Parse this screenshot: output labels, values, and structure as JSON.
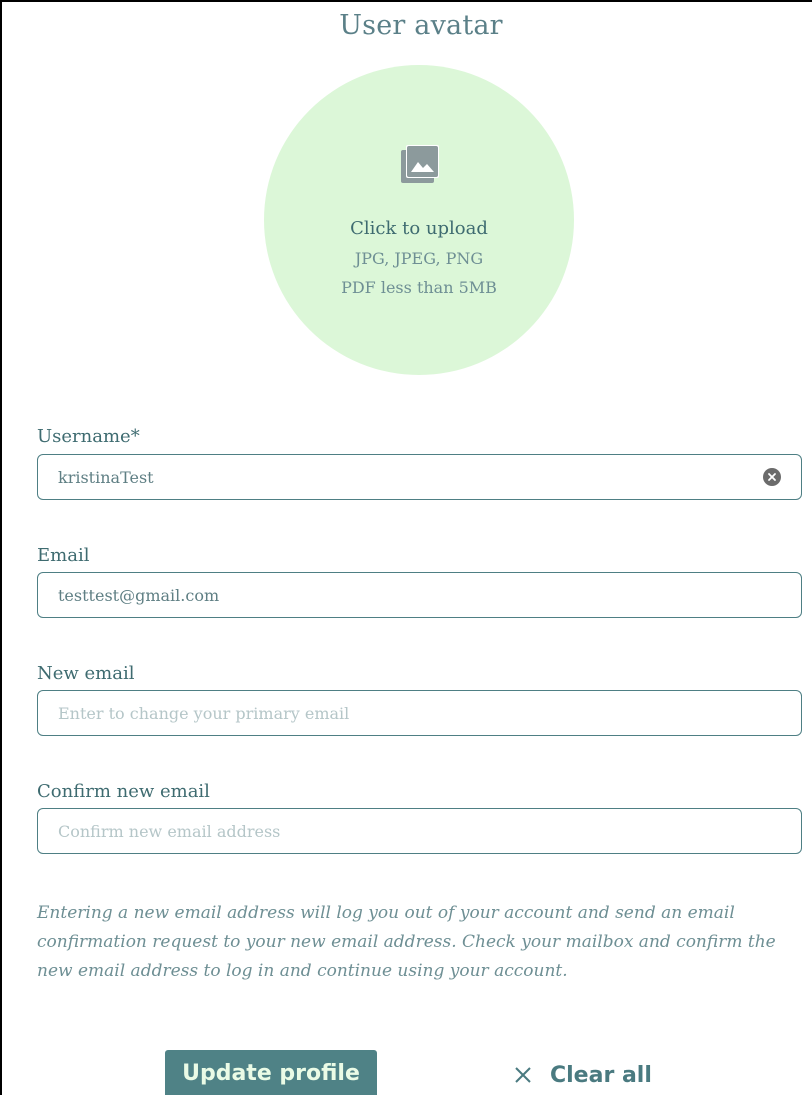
{
  "section": {
    "title": "User avatar"
  },
  "upload": {
    "icon": "image-gallery-icon",
    "label": "Click to upload",
    "formats": "JPG, JPEG, PNG",
    "limit": "PDF less than 5MB"
  },
  "fields": {
    "username": {
      "label": "Username*",
      "value": "kristinaTest"
    },
    "email": {
      "label": "Email",
      "value": "testtest@gmail.com"
    },
    "new_email": {
      "label": "New email",
      "placeholder": "Enter to change your primary email"
    },
    "confirm_email": {
      "label": "Confirm new email",
      "placeholder": "Confirm new email address"
    }
  },
  "note": "Entering a new email address will log you out of your account and send an email confirmation request to your new email address. Check your mailbox and confirm the new email address to log in and continue using your account.",
  "actions": {
    "update_label": "Update profile",
    "clear_label": "Clear all"
  },
  "colors": {
    "accent": "#4f8286",
    "upload_bg": "#dcf7d8",
    "text": "#4a7a80"
  }
}
